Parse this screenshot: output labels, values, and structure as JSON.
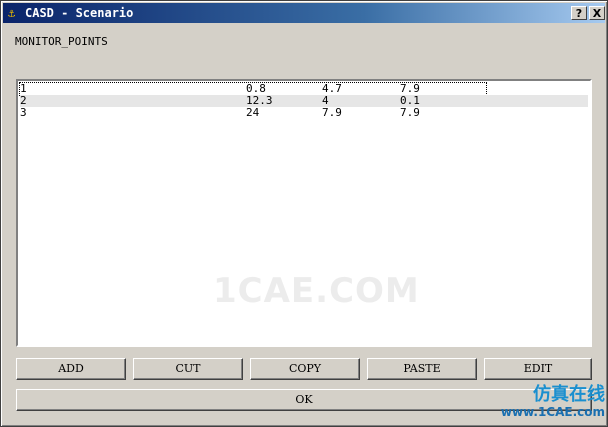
{
  "window": {
    "title": "CASD - Scenario",
    "help_label": "?",
    "close_label": "X"
  },
  "section_label": "MONITOR_POINTS",
  "rows": [
    [
      "1",
      "0.8",
      "4.7",
      "7.9"
    ],
    [
      "2",
      "12.3",
      "4",
      "0.1"
    ],
    [
      "3",
      "24",
      "7.9",
      "7.9"
    ]
  ],
  "buttons": {
    "add": "ADD",
    "cut": "CUT",
    "copy": "COPY",
    "paste": "PASTE",
    "edit": "EDIT",
    "ok": "OK"
  },
  "watermark": "1CAE.COM",
  "brand": {
    "cn": "仿真在线",
    "url": "www.1CAE.com"
  },
  "colors": {
    "titlebar_start": "#0a246a",
    "titlebar_end": "#a6caf0",
    "face": "#d4d0c8"
  }
}
